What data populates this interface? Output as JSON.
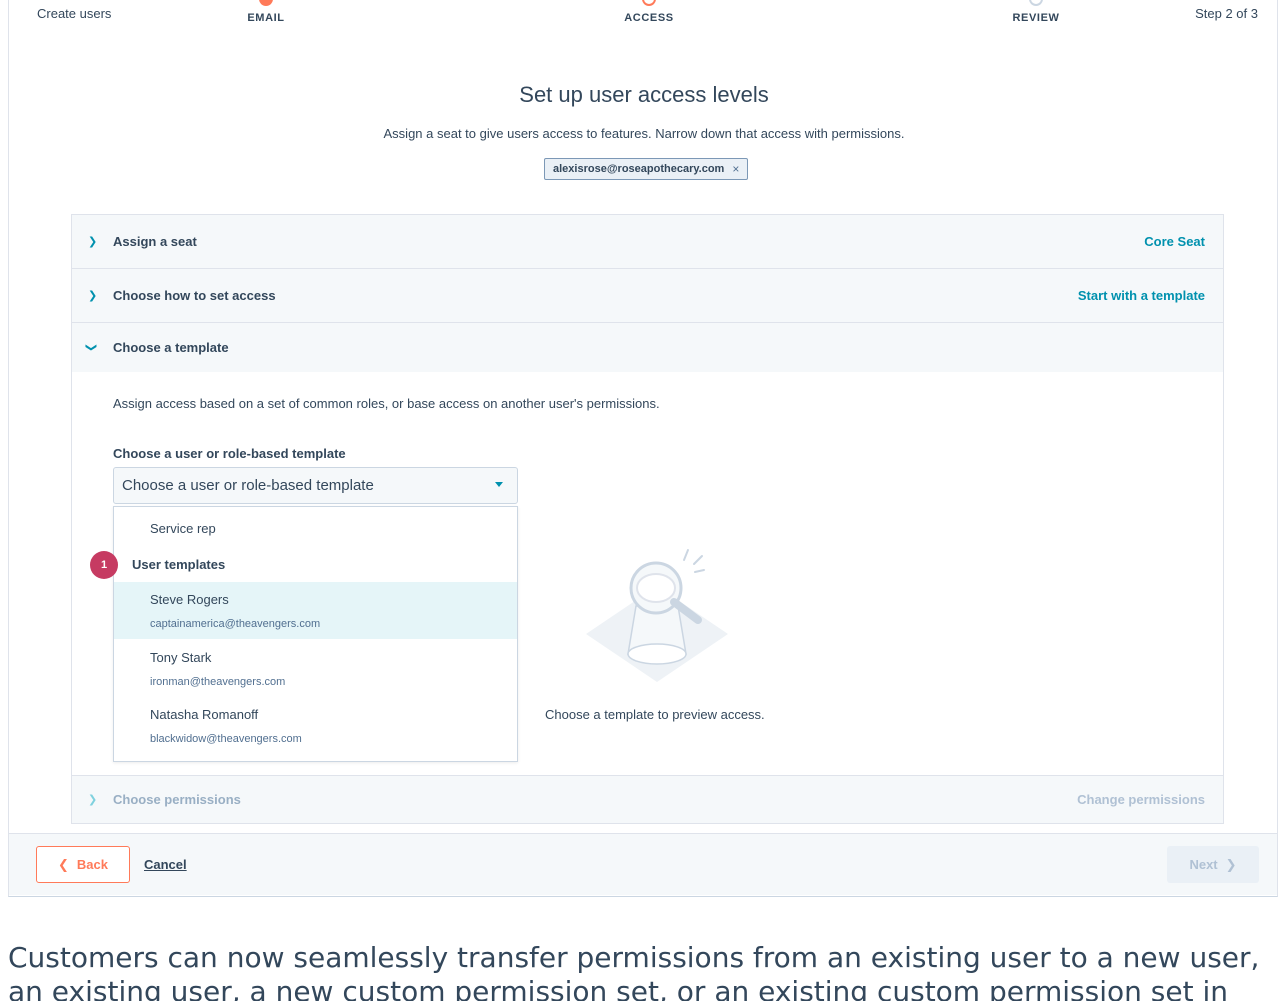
{
  "header": {
    "title": "Create users",
    "step_indicator": "Step 2 of 3",
    "steps": [
      {
        "label": "EMAIL"
      },
      {
        "label": "ACCESS"
      },
      {
        "label": "REVIEW"
      }
    ]
  },
  "page": {
    "title": "Set up user access levels",
    "subtitle": "Assign a seat to give users access to features. Narrow down that access with permissions.",
    "email_tag": "alexisrose@roseapothecary.com",
    "email_tag_remove": "×"
  },
  "accordion": {
    "assign_seat": {
      "label": "Assign a seat",
      "value": "Core Seat"
    },
    "access_method": {
      "label": "Choose how to set access",
      "value": "Start with a template"
    },
    "template": {
      "label": "Choose a template",
      "description": "Assign access based on a set of common roles, or base access on another user's permissions.",
      "field_label": "Choose a user or role-based template",
      "select_value": "Choose a user or role-based template",
      "dropdown": {
        "service_option": "Service rep",
        "group_label": "User templates",
        "users": [
          {
            "name": "Steve Rogers",
            "email": "captainamerica@theavengers.com"
          },
          {
            "name": "Tony Stark",
            "email": "ironman@theavengers.com"
          },
          {
            "name": "Natasha Romanoff",
            "email": "blackwidow@theavengers.com"
          }
        ]
      },
      "preview_text": "Choose a template to preview access."
    },
    "permissions": {
      "label": "Choose permissions",
      "value": "Change permissions"
    }
  },
  "badge": "1",
  "footer": {
    "back": "Back",
    "cancel": "Cancel",
    "next": "Next"
  },
  "caption": "Customers can now seamlessly transfer permissions from an existing user to a new user, an existing user, a new custom permission set, or an existing custom permission set in HubSpot"
}
